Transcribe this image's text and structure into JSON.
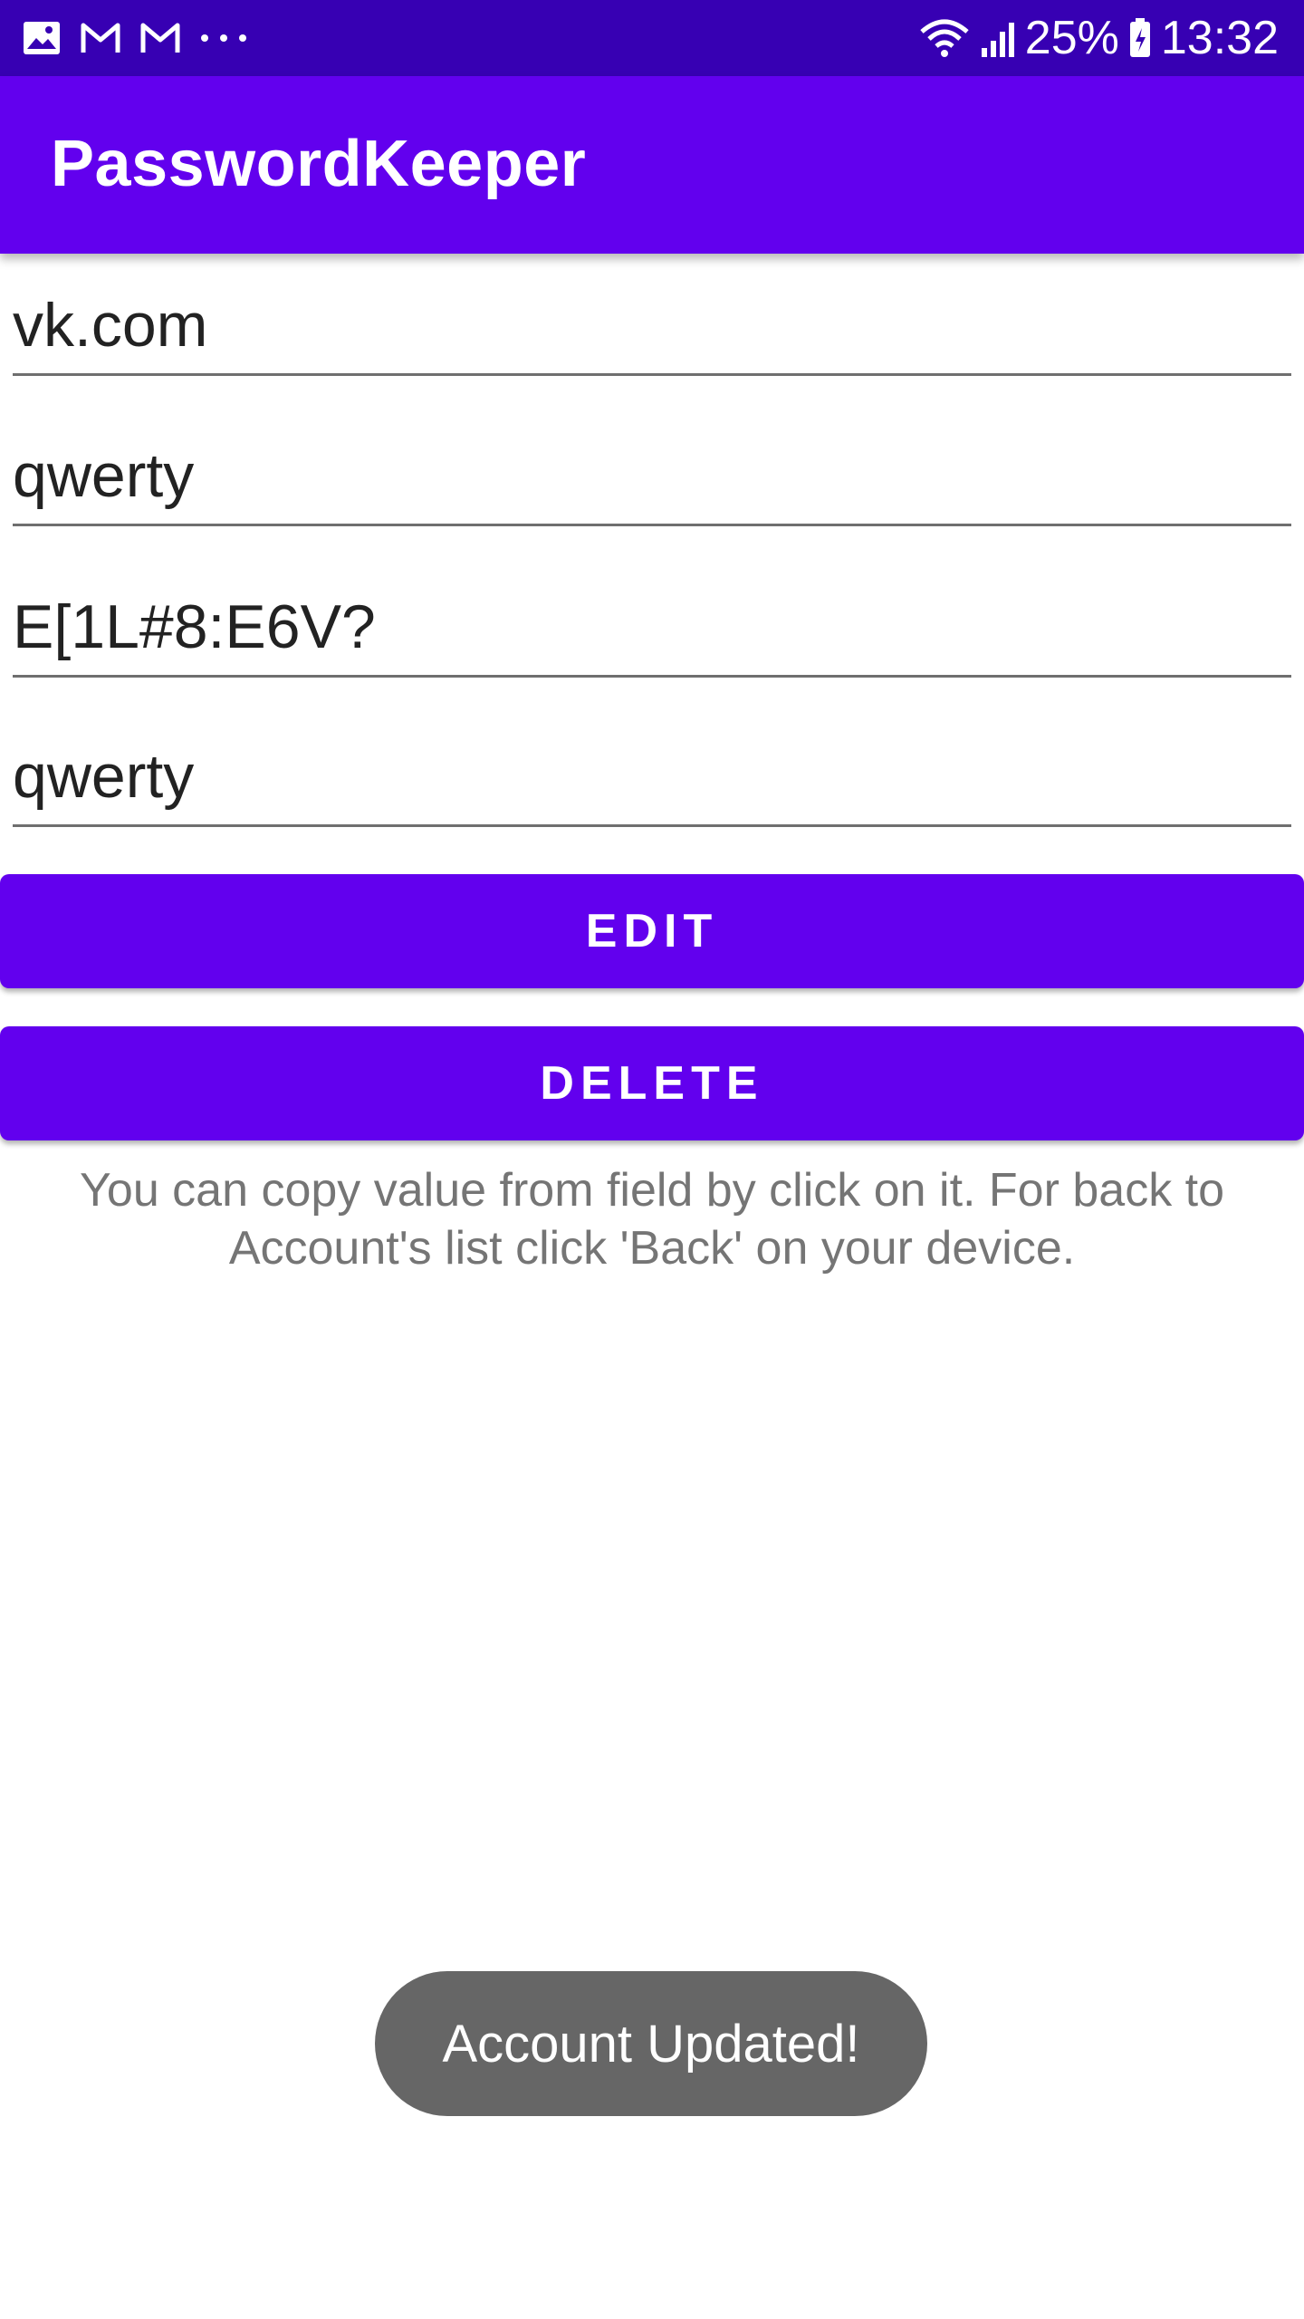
{
  "status_bar": {
    "icons_left": [
      "gallery-icon",
      "gmail-icon",
      "gmail-icon",
      "more-dots-icon"
    ],
    "icons_right": [
      "wifi-icon",
      "signal-icon",
      "battery-icon"
    ],
    "battery_percent": "25%",
    "time": "13:32"
  },
  "app_bar": {
    "title": "PasswordKeeper"
  },
  "fields": {
    "site": "vk.com",
    "login": "qwerty",
    "password": "E[1L#8:E6V?",
    "note": "qwerty"
  },
  "buttons": {
    "edit": "EDIT",
    "delete": "DELETE"
  },
  "hint": "You can copy value from field by click on it. For back to Account's list click 'Back' on your device.",
  "toast": "Account Updated!",
  "colors": {
    "primary": "#6200ee",
    "primary_dark": "#3700b3",
    "toast_bg": "#666666",
    "hint_text": "#757575"
  }
}
